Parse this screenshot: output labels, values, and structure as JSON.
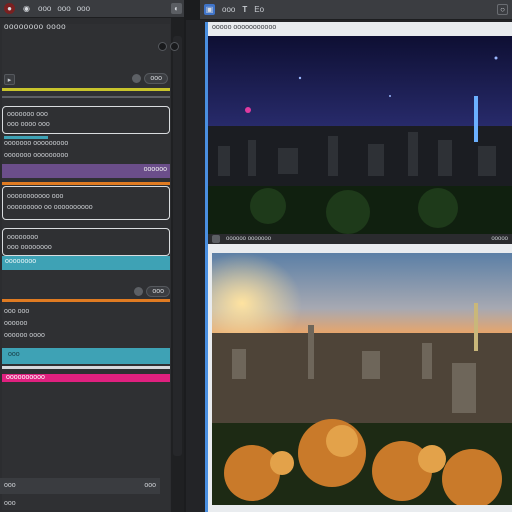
{
  "left_toolbar": {
    "label_a": "ooo",
    "label_b": "ooo",
    "label_c": "ooo"
  },
  "right_toolbar": {
    "label_a": "ooo",
    "label_b": "T",
    "label_c": "Eo"
  },
  "left_panel": {
    "title": "oooooooo oooo",
    "section1_pill": "ooo",
    "card1_lines": [
      "ooooooo ooo",
      "ooo oooo ooo",
      "ooooooo ooooooooo"
    ],
    "purple_bar_text": "oooooo",
    "card2_lines": [
      "ooooooooooo ooo",
      "ooooooooo oo oooooooooo"
    ],
    "card3_lines": [
      "oooooooo",
      "ooo oooooooo"
    ],
    "teal_bar_text": "oooooooo",
    "section2_pill": "ooo",
    "list_lines": [
      "ooo ooo",
      "oooooo",
      "oooooo oooo"
    ],
    "teal2_text": "ooo",
    "pink_bar_text": "oooooooooo",
    "footer_left": "ooo",
    "footer_right": "ooo"
  },
  "viewer": {
    "header": "ooooo ooooooooooo",
    "strip_text": "oooooo ooooooo",
    "strip_right": "ooooo"
  },
  "colors": {
    "accent_yellow": "#c8c42c",
    "accent_purple": "#6b4e8a",
    "accent_orange": "#e07b22",
    "accent_teal": "#3ea2b5",
    "accent_pink": "#e0207f",
    "viewer_border": "#4a8fe0"
  },
  "icons": {
    "app": "app-logo-icon",
    "cube": "cube-icon",
    "close": "close-icon",
    "search": "search-icon",
    "settings": "settings-icon"
  }
}
